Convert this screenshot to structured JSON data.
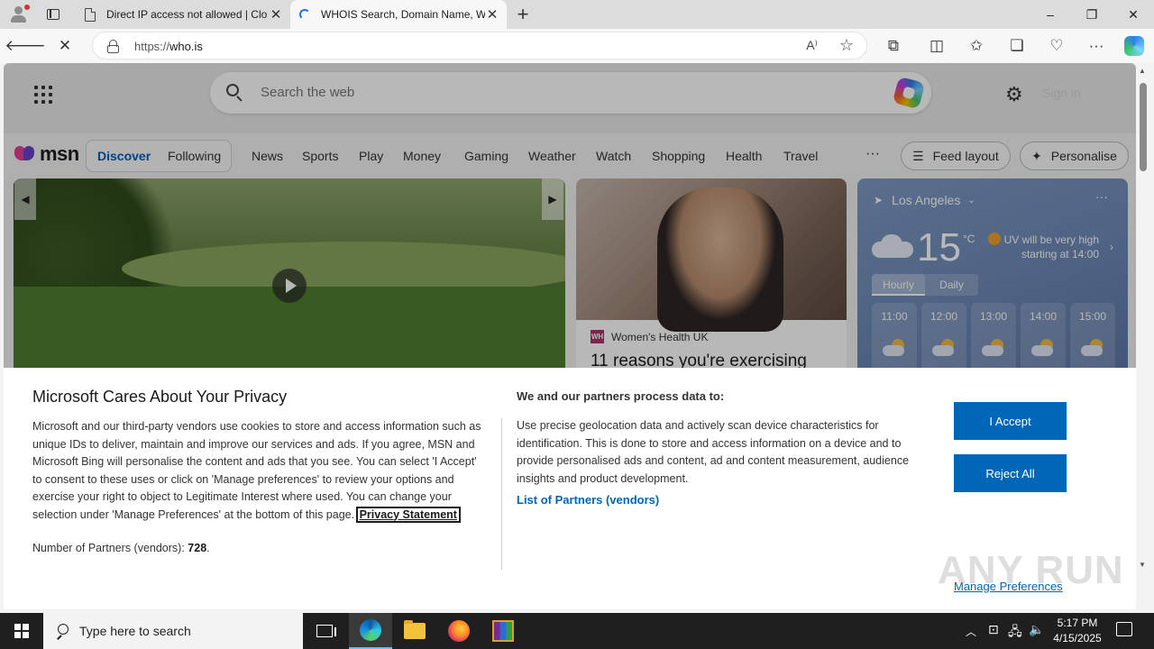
{
  "browser": {
    "tabs": [
      {
        "title": "Direct IP access not allowed | Clo",
        "active": false
      },
      {
        "title": "WHOIS Search, Domain Name, W",
        "active": true
      }
    ],
    "new_tab_label": "+",
    "window_controls": {
      "minimize": "–",
      "restore": "❐",
      "close": "✕"
    },
    "address": {
      "scheme": "https://",
      "host": "who.is"
    }
  },
  "msn": {
    "search_placeholder": "Search the web",
    "signin_text": "Sign in",
    "logo_text": "msn",
    "feed_tabs": {
      "discover": "Discover",
      "following": "Following"
    },
    "nav_items": [
      "News",
      "Sports",
      "Play",
      "Money",
      "Gaming",
      "Weather",
      "Watch",
      "Shopping",
      "Health",
      "Travel"
    ],
    "nav_more": "···",
    "feed_layout": "Feed layout",
    "personalise": "Personalise",
    "card2": {
      "source": "Women's Health UK",
      "source_logo": "WH",
      "headline": "11 reasons you're exercising"
    },
    "weather": {
      "location": "Los Angeles",
      "temperature": "15",
      "unit": "°C",
      "uv_line1": "UV will be very high",
      "uv_line2": "starting at 14:00",
      "tab_hourly": "Hourly",
      "tab_daily": "Daily",
      "hours": [
        "11:00",
        "12:00",
        "13:00",
        "14:00",
        "15:00"
      ]
    }
  },
  "privacy": {
    "title": "Microsoft Cares About Your Privacy",
    "body": "Microsoft and our third-party vendors use cookies to store and access information such as unique IDs to deliver, maintain and improve our services and ads. If you agree, MSN and Microsoft Bing will personalise the content and ads that you see. You can select 'I Accept' to consent to these uses or click on 'Manage preferences' to review your options and exercise your right to object to Legitimate Interest where used.  You can change your selection under 'Manage Preferences' at the bottom of this page.",
    "privacy_link": "Privacy Statement",
    "partners_label": "Number of Partners (vendors):",
    "partners_count": "728",
    "partners_suffix": ".",
    "process_title": "We and our partners process data to:",
    "process_body": "Use precise geolocation data and actively scan device characteristics for identification. This is done to store and access information on a device and to provide personalised ads and content, ad and content measurement, audience insights and product development.",
    "vendors_link": "List of Partners (vendors)",
    "accept": "I Accept",
    "reject": "Reject All",
    "manage": "Manage Preferences"
  },
  "watermark": "ANY RUN",
  "taskbar": {
    "search_placeholder": "Type here to search",
    "time": "5:17 PM",
    "date": "4/15/2025"
  },
  "colors": {
    "accent": "#0067b8",
    "msn_discover": "#005fb8"
  }
}
